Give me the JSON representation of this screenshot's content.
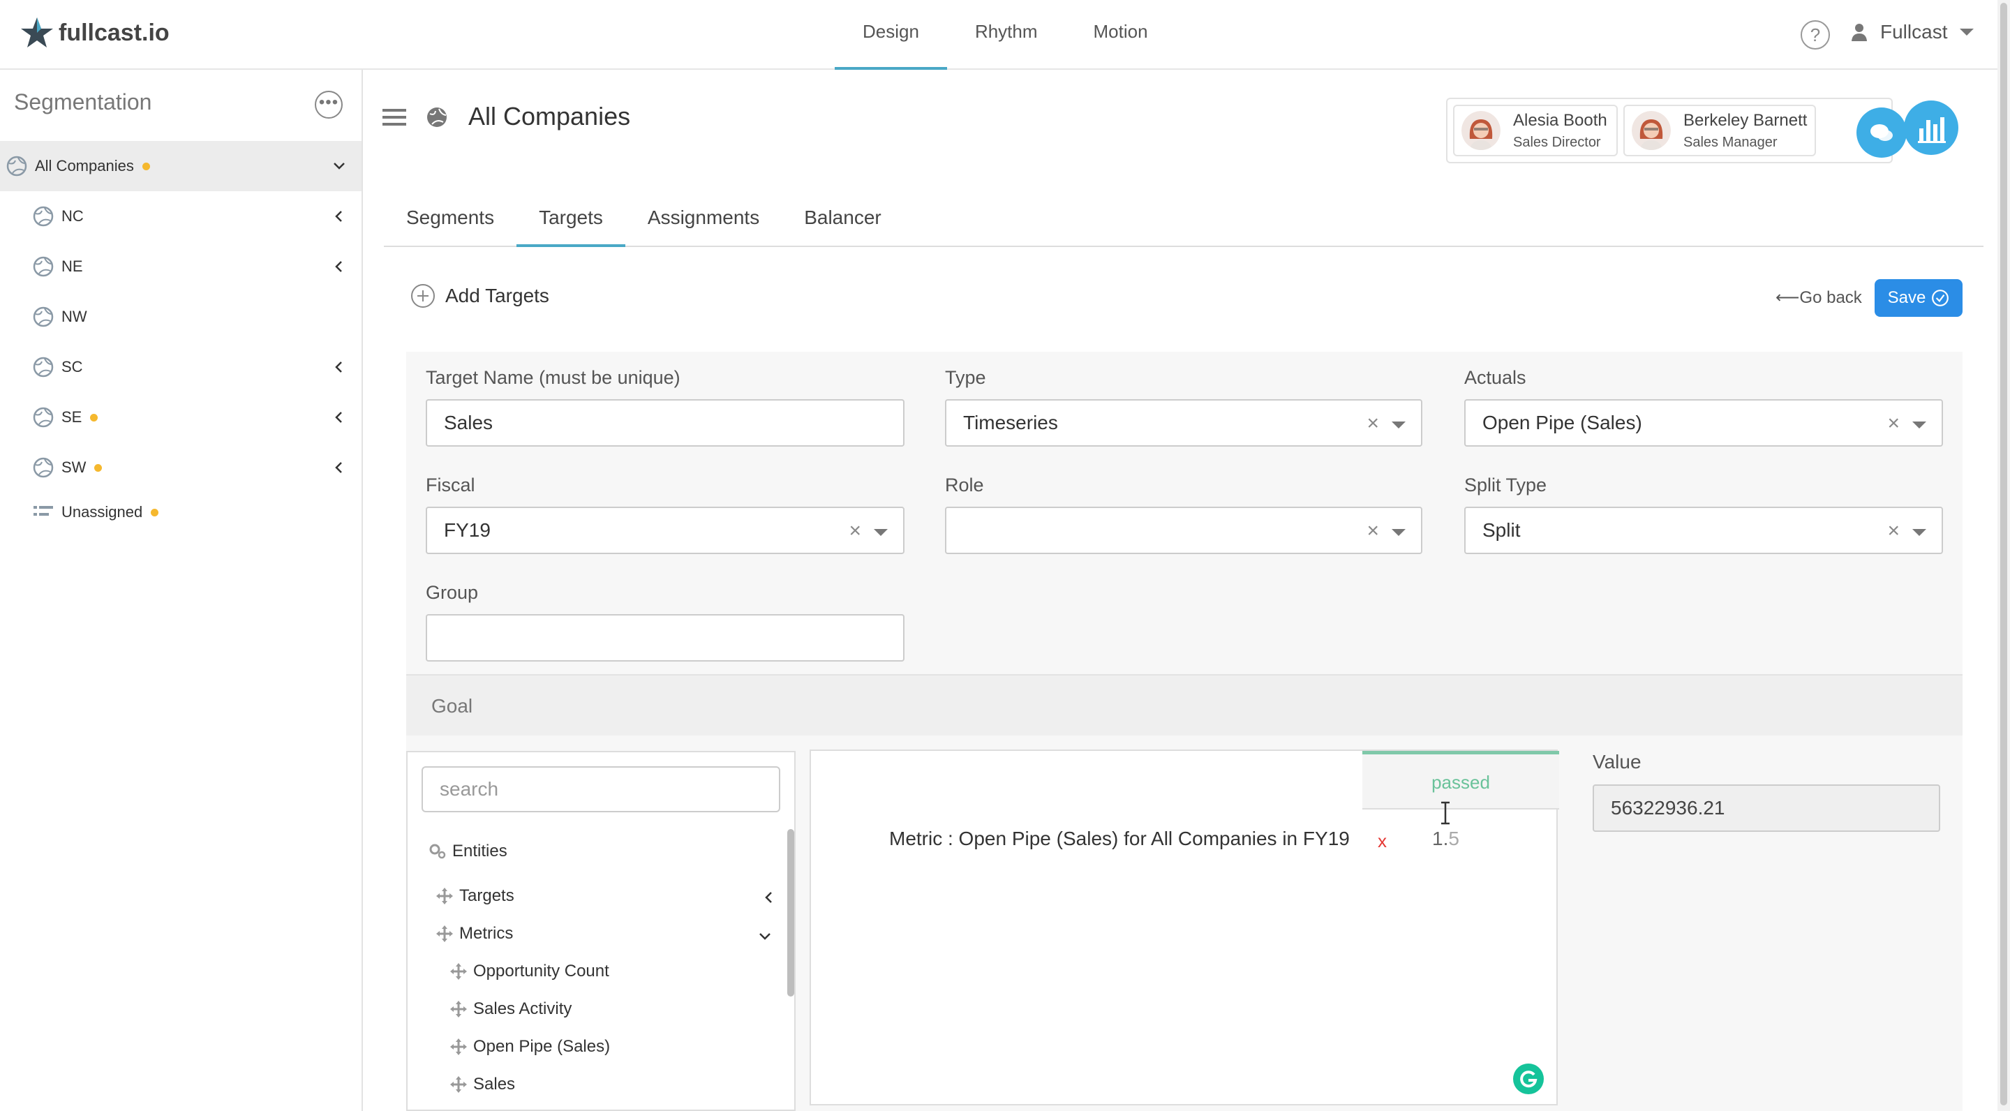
{
  "app": {
    "logo_text": "fullcast.io",
    "nav": [
      "Design",
      "Rhythm",
      "Motion"
    ],
    "active_nav": "Design",
    "help_label": "?",
    "user_name": "Fullcast"
  },
  "sidebar": {
    "title": "Segmentation",
    "items": [
      {
        "label": "All Companies",
        "dot": true
      },
      {
        "label": "NC"
      },
      {
        "label": "NE"
      },
      {
        "label": "NW"
      },
      {
        "label": "SC"
      },
      {
        "label": "SE",
        "dot": true
      },
      {
        "label": "SW",
        "dot": true
      },
      {
        "label": "Unassigned",
        "dot": true
      }
    ]
  },
  "header": {
    "title": "All Companies",
    "people": [
      {
        "name": "Alesia Booth",
        "role": "Sales Director"
      },
      {
        "name": "Berkeley Barnett",
        "role": "Sales Manager"
      }
    ]
  },
  "tabs": [
    "Segments",
    "Targets",
    "Assignments",
    "Balancer"
  ],
  "active_tab": "Targets",
  "actions": {
    "add_targets": "Add Targets",
    "go_back": "Go back",
    "save": "Save"
  },
  "form": {
    "target_name": {
      "label": "Target Name (must be unique)",
      "value": "Sales"
    },
    "type": {
      "label": "Type",
      "value": "Timeseries"
    },
    "actuals": {
      "label": "Actuals",
      "value": "Open Pipe (Sales)"
    },
    "fiscal": {
      "label": "Fiscal",
      "value": "FY19"
    },
    "role": {
      "label": "Role",
      "value": ""
    },
    "split_type": {
      "label": "Split Type",
      "value": "Split"
    },
    "group": {
      "label": "Group",
      "value": ""
    }
  },
  "goal": {
    "title": "Goal",
    "search_placeholder": "search",
    "tree": {
      "root": "Entities",
      "targets": "Targets",
      "metrics": "Metrics",
      "metric_items": [
        "Opportunity Count",
        "Sales Activity",
        "Open Pipe (Sales)",
        "Sales"
      ]
    },
    "formula": {
      "status": "passed",
      "metric_text": "Metric : Open Pipe (Sales) for All Companies in FY19",
      "operator": "x",
      "number_main": "1.",
      "number_faint": "5"
    },
    "value": {
      "label": "Value",
      "value": "56322936.21"
    }
  },
  "colors": {
    "accent": "#3eaee6",
    "save": "#2b8de6",
    "dot": "#f5b82e",
    "passed": "#6ac29a"
  }
}
